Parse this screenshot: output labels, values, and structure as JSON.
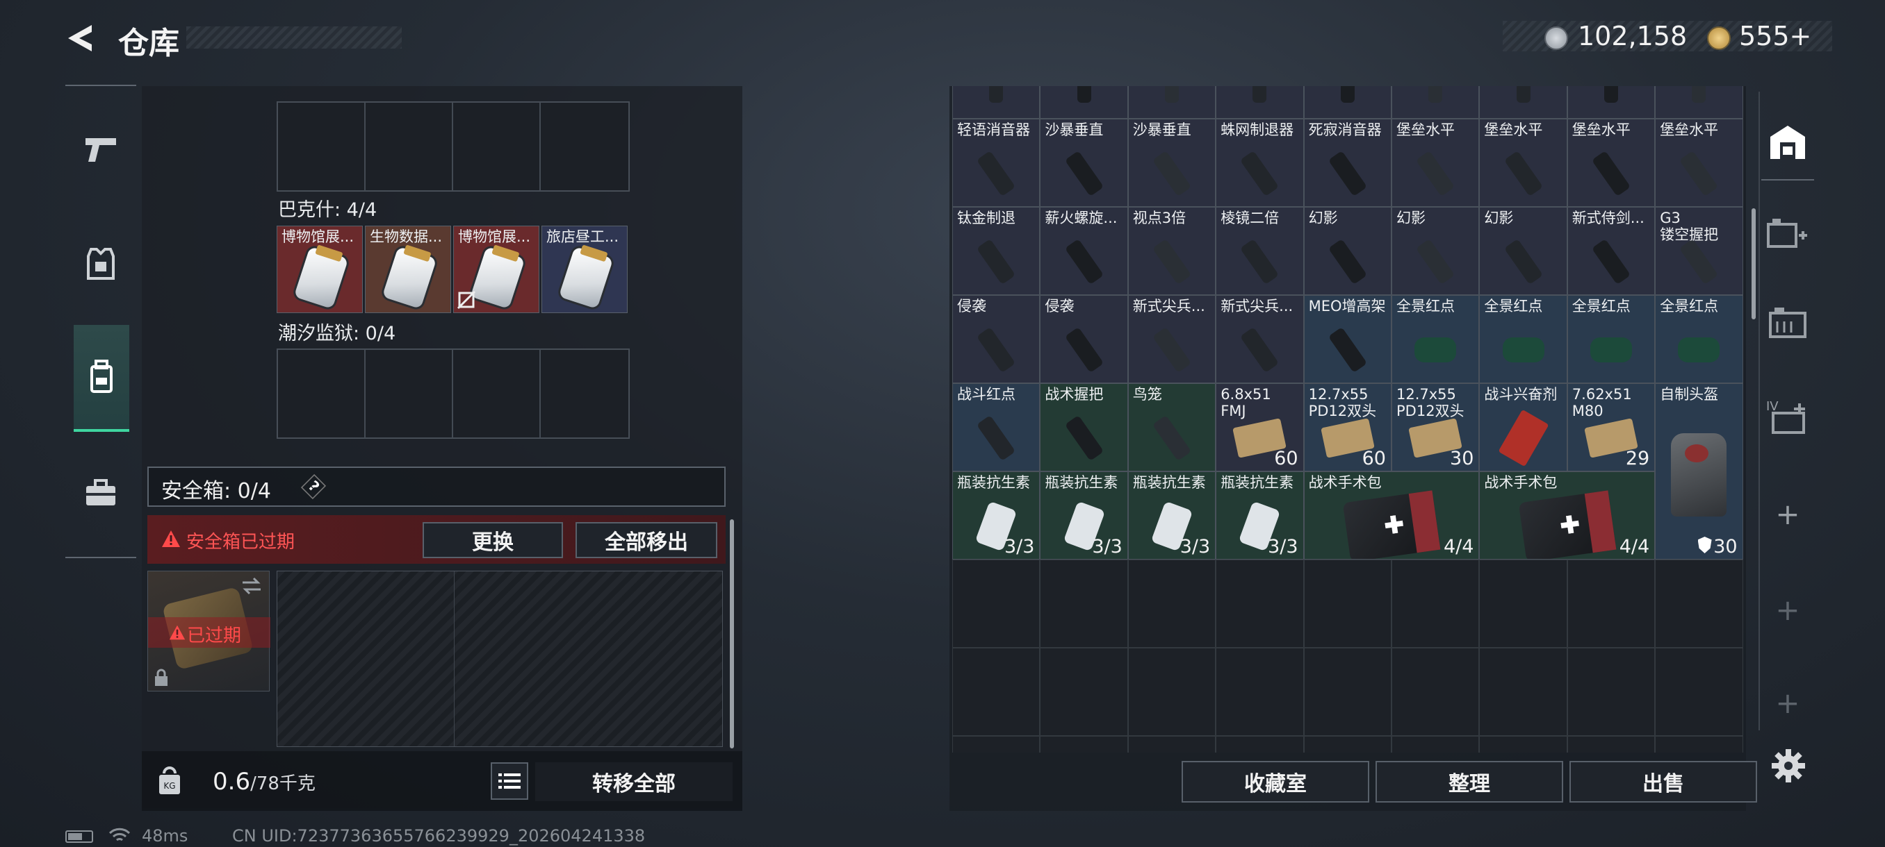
{
  "header": {
    "title": "仓库",
    "currency1": "102,158",
    "currency2": "555+"
  },
  "left_tabs": [
    "weapon-icon",
    "armor-icon",
    "backpack-icon",
    "toolbox-icon"
  ],
  "containers": [
    {
      "title": "",
      "items": []
    },
    {
      "title": "巴克什: 4/4",
      "items": [
        {
          "label": "博物馆展...",
          "color": "#6a2a2c"
        },
        {
          "label": "生物数据...",
          "color": "#5a3a30"
        },
        {
          "label": "博物馆展...",
          "color": "#6a2a2c"
        },
        {
          "label": "旅店昼工...",
          "color": "#2f3652"
        }
      ]
    },
    {
      "title": "潮汐监狱: 0/4",
      "items": []
    }
  ],
  "safebox": {
    "title": "安全箱: 0/4",
    "help": "?",
    "expired_warning": "安全箱已过期",
    "replace_button": "更换",
    "move_all_button": "全部移出",
    "expired_badge": "已过期"
  },
  "footer_left": {
    "weight": "0.6",
    "weight_max": "/78千克",
    "transfer_all": "转移全部"
  },
  "status": {
    "ping": "48ms",
    "uid": "CN UID:7237736365576623992‌9_202604241338"
  },
  "grid": {
    "rows": [
      [
        {
          "label": "",
          "bg": "#2b2f3f"
        },
        {
          "label": "",
          "bg": "#2b2f3f"
        },
        {
          "label": "",
          "bg": "#2b2f3f"
        },
        {
          "label": "",
          "bg": "#2b2f3f"
        },
        {
          "label": "",
          "bg": "#2b2f3f"
        },
        {
          "label": "",
          "bg": "#2b2f3f"
        },
        {
          "label": "",
          "bg": "#2b2f3f"
        },
        {
          "label": "",
          "bg": "#2b2f3f"
        },
        {
          "label": "",
          "bg": "#2b2f3f"
        }
      ],
      [
        {
          "label": "轻语消音器",
          "bg": "#2b2f3f"
        },
        {
          "label": "沙暴垂直",
          "bg": "#2b2f3f"
        },
        {
          "label": "沙暴垂直",
          "bg": "#2b2f3f"
        },
        {
          "label": "蛛网制退器",
          "bg": "#2b2f3f"
        },
        {
          "label": "死寂消音器",
          "bg": "#2b2f3f"
        },
        {
          "label": "堡垒水平",
          "bg": "#2b2f3f"
        },
        {
          "label": "堡垒水平",
          "bg": "#2b2f3f"
        },
        {
          "label": "堡垒水平",
          "bg": "#2b2f3f"
        },
        {
          "label": "堡垒水平",
          "bg": "#2b2f3f"
        }
      ],
      [
        {
          "label": "钛金制退",
          "bg": "#2b2f3f"
        },
        {
          "label": "薪火螺旋...",
          "bg": "#2b2f3f"
        },
        {
          "label": "视点3倍",
          "bg": "#2b2f3f"
        },
        {
          "label": "棱镜二倍",
          "bg": "#2b2f3f"
        },
        {
          "label": "幻影",
          "bg": "#2b2f3f"
        },
        {
          "label": "幻影",
          "bg": "#2b2f3f"
        },
        {
          "label": "幻影",
          "bg": "#2b2f3f"
        },
        {
          "label": "新式侍剑...",
          "bg": "#2b2f3f"
        },
        {
          "label": "G3\n镂空握把",
          "bg": "#2b2f3f"
        }
      ],
      [
        {
          "label": "侵袭",
          "bg": "#2b2f3f"
        },
        {
          "label": "侵袭",
          "bg": "#2b2f3f"
        },
        {
          "label": "新式尖兵...",
          "bg": "#2b2f3f"
        },
        {
          "label": "新式尖兵...",
          "bg": "#2b2f3f"
        },
        {
          "label": "MEO增高架",
          "bg": "#2a3b4e"
        },
        {
          "label": "全景红点",
          "bg": "#2a3b4e"
        },
        {
          "label": "全景红点",
          "bg": "#2a3b4e"
        },
        {
          "label": "全景红点",
          "bg": "#2a3b4e"
        },
        {
          "label": "全景红点",
          "bg": "#2a3b4e"
        }
      ],
      [
        {
          "label": "战斗红点",
          "bg": "#2a3b4e"
        },
        {
          "label": "战术握把",
          "bg": "#233b34"
        },
        {
          "label": "鸟笼",
          "bg": "#233b34"
        },
        {
          "label": "6.8x51\nFMJ",
          "bg": "#2b2f3f",
          "count": "60"
        },
        {
          "label": "12.7x55\nPD12双头",
          "bg": "#2a3b4e",
          "count": "60"
        },
        {
          "label": "12.7x55\nPD12双头",
          "bg": "#2a3b4e",
          "count": "30"
        },
        {
          "label": "战斗兴奋剂",
          "bg": "#2a3b4e"
        },
        {
          "label": "7.62x51\nM80",
          "bg": "#2a3b4e",
          "count": "29"
        }
      ],
      [
        {
          "label": "瓶装抗生素",
          "bg": "#233b34",
          "count": "3/3"
        },
        {
          "label": "瓶装抗生素",
          "bg": "#233b34",
          "count": "3/3"
        },
        {
          "label": "瓶装抗生素",
          "bg": "#233b34",
          "count": "3/3"
        },
        {
          "label": "瓶装抗生素",
          "bg": "#233b34",
          "count": "3/3"
        }
      ]
    ],
    "first_aid": [
      {
        "label": "战术手术包",
        "count": "4/4"
      },
      {
        "label": "战术手术包",
        "count": "4/4"
      }
    ],
    "helmet": {
      "label": "自制头盔",
      "count": "30"
    }
  },
  "right_buttons": {
    "collection": "收藏室",
    "organize": "整理",
    "sell": "出售"
  },
  "right_side": [
    "stash-icon",
    "add-storage-icon",
    "storage-box-icon",
    "storage-iv-icon",
    "plus-icon",
    "plus-icon",
    "plus-icon"
  ]
}
